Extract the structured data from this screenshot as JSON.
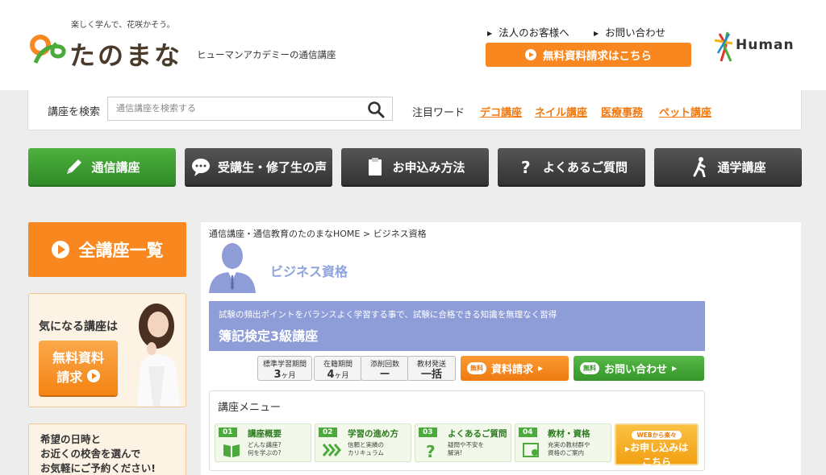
{
  "header": {
    "tagline": "楽しく学んで、花咲かそう。",
    "logo": "たのまな",
    "logo_sub": "ヒューマンアカデミーの通信講座",
    "links": [
      "法人のお客様へ",
      "お問い合わせ"
    ],
    "request_button": "無料資料請求はこちら",
    "brand": "Human"
  },
  "search": {
    "label": "講座を検索",
    "placeholder": "通信講座を検索する",
    "keyword_label": "注目ワード",
    "keywords": [
      "デコ講座",
      "ネイル講座",
      "医療事務",
      "ペット講座"
    ]
  },
  "nav": {
    "items": [
      "通信講座",
      "受講生・修了生の声",
      "お申込み方法",
      "よくあるご質問",
      "通学講座"
    ]
  },
  "sidebar": {
    "all_courses": "全講座一覧",
    "interest_title": "気になる講座は",
    "free_request_line1": "無料資料",
    "free_request_line2": "請求",
    "visit_text": [
      "希望の日時と",
      "お近くの校舎を選んで",
      "お気軽にご予約ください!"
    ]
  },
  "content": {
    "breadcrumb": "通信講座・通信教育のたのまなHOME > ビジネス資格",
    "category": "ビジネス資格",
    "course_desc": "試験の頻出ポイントをバランスよく学習する事で、試験に合格できる知識を無理なく習得",
    "course_name": "簿記検定3級講座",
    "specs": [
      {
        "label": "標準学習期間",
        "value": "3",
        "unit": "ヶ月"
      },
      {
        "label": "在籍期間",
        "value": "4",
        "unit": "ヶ月"
      },
      {
        "label": "添削回数",
        "value": "ー",
        "unit": ""
      },
      {
        "label": "教材発送",
        "value": "一括",
        "unit": ""
      }
    ],
    "action_badge": "無料",
    "action_request": "資料請求",
    "action_contact": "お問い合わせ",
    "menu_title": "講座メニュー",
    "menu_items": [
      {
        "num": "01",
        "title": "講座概要",
        "desc1": "どんな講座?",
        "desc2": "何を学ぶの?"
      },
      {
        "num": "02",
        "title": "学習の進め方",
        "desc1": "信頼と実績の",
        "desc2": "カリキュラム"
      },
      {
        "num": "03",
        "title": "よくあるご質問",
        "desc1": "疑問や不安を",
        "desc2": "解消!"
      },
      {
        "num": "04",
        "title": "教材・資格",
        "desc1": "充実の教材群や",
        "desc2": "資格のご案内"
      }
    ],
    "web_small": "WEBから楽々",
    "web_line1": "お申し込みは",
    "web_line2": "こちら"
  },
  "colors": {
    "accent_orange": "#f7871e",
    "green": "#3d9e30",
    "course_blue": "#8e9cd8"
  }
}
